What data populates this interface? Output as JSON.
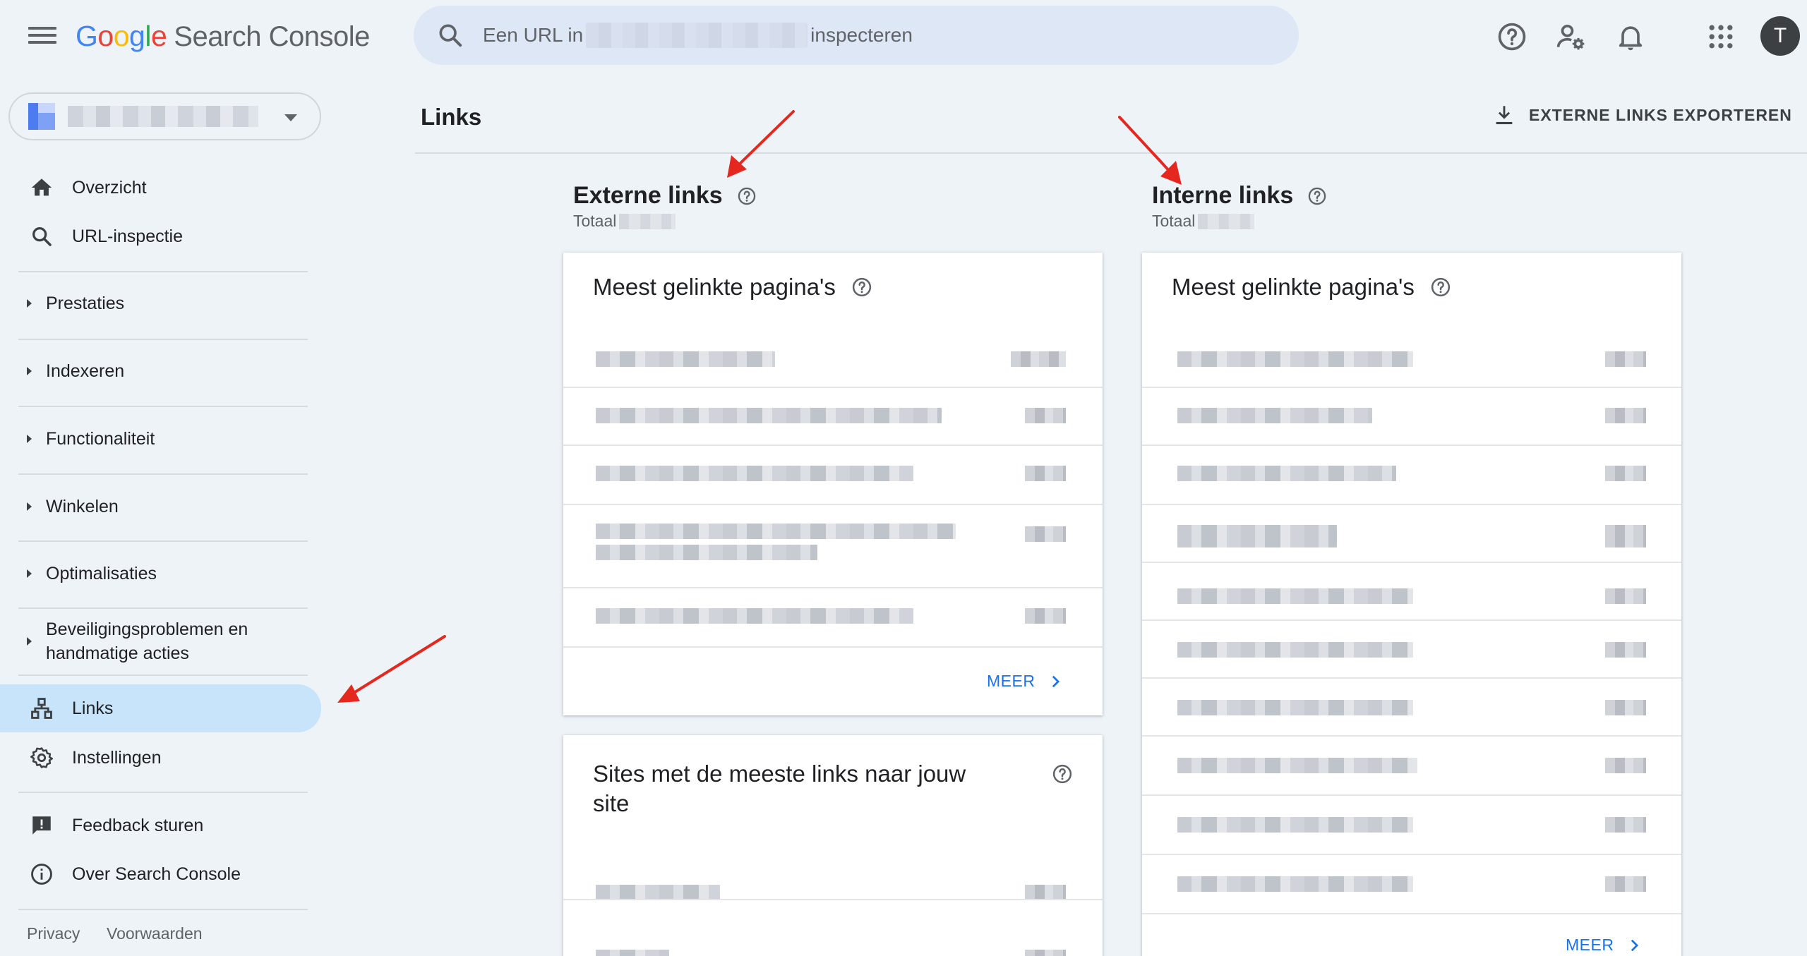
{
  "app": {
    "logo_google": [
      "G",
      "o",
      "o",
      "g",
      "l",
      "e"
    ],
    "product_name": "Search Console",
    "search": {
      "placeholder_before": "Een URL in",
      "placeholder_after": "inspecteren"
    },
    "avatar_initial": "T",
    "icons": [
      "menu-icon",
      "search-icon",
      "help-icon",
      "admin-settings-icon",
      "notifications-icon",
      "apps-grid-icon"
    ]
  },
  "sidebar": {
    "items_top": [
      {
        "label": "Overzicht",
        "icon": "home-icon"
      },
      {
        "label": "URL-inspectie",
        "icon": "search-icon"
      }
    ],
    "groups": [
      {
        "label": "Prestaties"
      },
      {
        "label": "Indexeren"
      },
      {
        "label": "Functionaliteit"
      },
      {
        "label": "Winkelen"
      },
      {
        "label": "Optimalisaties"
      },
      {
        "label_line1": "Beveiligingsproblemen en",
        "label_line2": "handmatige acties"
      }
    ],
    "items_bottom": [
      {
        "label": "Links",
        "icon": "links-icon",
        "active": true
      },
      {
        "label": "Instellingen",
        "icon": "settings-icon"
      }
    ],
    "items_extra": [
      {
        "label": "Feedback sturen",
        "icon": "feedback-icon"
      },
      {
        "label": "Over Search Console",
        "icon": "info-icon"
      }
    ],
    "footer": {
      "privacy": "Privacy",
      "terms": "Voorwaarden"
    }
  },
  "main": {
    "page_title": "Links",
    "export_label": "EXTERNE LINKS EXPORTEREN",
    "external": {
      "title": "Externe links",
      "total_label": "Totaal",
      "top_pages": {
        "title": "Meest gelinkte pagina's",
        "more": "MEER"
      },
      "top_sites": {
        "title_line1": "Sites met de meeste links naar jouw",
        "title_line2": "site"
      }
    },
    "internal": {
      "title": "Interne links",
      "total_label": "Totaal",
      "top_pages": {
        "title": "Meest gelinkte pagina's",
        "more": "MEER"
      }
    }
  },
  "colors": {
    "background": "#eef3f8",
    "search_bg": "#dde7f6",
    "active_nav": "#c8e4fb",
    "link_blue": "#1a73e8",
    "annotation_red": "#e5281f"
  }
}
